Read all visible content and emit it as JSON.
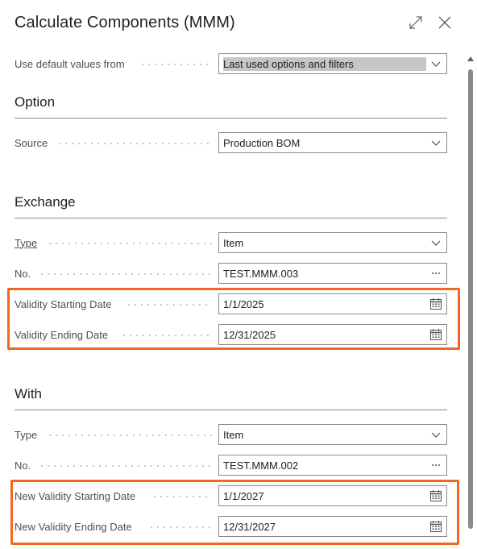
{
  "dialog": {
    "title": "Calculate Components (MMM)"
  },
  "defaults": {
    "label": "Use default values from",
    "value": "Last used options and filters"
  },
  "option": {
    "heading": "Option",
    "source_label": "Source",
    "source_value": "Production BOM"
  },
  "exchange": {
    "heading": "Exchange",
    "type_label": "Type",
    "type_value": "Item",
    "no_label": "No.",
    "no_value": "TEST.MMM.003",
    "start_label": "Validity Starting Date",
    "start_value": "1/1/2025",
    "end_label": "Validity Ending Date",
    "end_value": "12/31/2025"
  },
  "with": {
    "heading": "With",
    "type_label": "Type",
    "type_value": "Item",
    "no_label": "No.",
    "no_value": "TEST.MMM.002",
    "start_label": "New Validity Starting Date",
    "start_value": "1/1/2027",
    "end_label": "New Validity Ending Date",
    "end_value": "12/31/2027"
  },
  "colors": {
    "highlight": "#f26722"
  }
}
